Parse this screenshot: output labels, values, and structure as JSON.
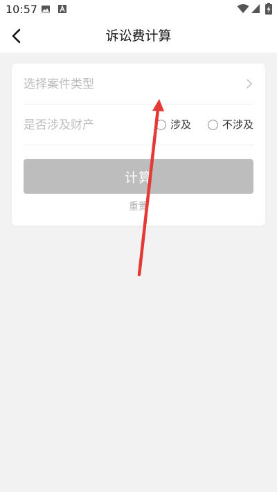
{
  "status_bar": {
    "time": "10:57",
    "icons": [
      "image-icon",
      "a-letter-icon",
      "wifi-icon",
      "signal-icon",
      "battery-charging-icon"
    ]
  },
  "app_bar": {
    "title": "诉讼费计算",
    "back_icon": "chevron-left-icon"
  },
  "form": {
    "case_type_placeholder": "选择案件类型",
    "property_label": "是否涉及财产",
    "options": [
      {
        "label": "涉及",
        "selected": false
      },
      {
        "label": "不涉及",
        "selected": false
      }
    ],
    "calculate_label": "计算",
    "reset_label": "重置"
  },
  "colors": {
    "background": "#f2f2f2",
    "card": "#ffffff",
    "button_disabled": "#bdbdbd",
    "annotation_arrow": "#e53935"
  }
}
